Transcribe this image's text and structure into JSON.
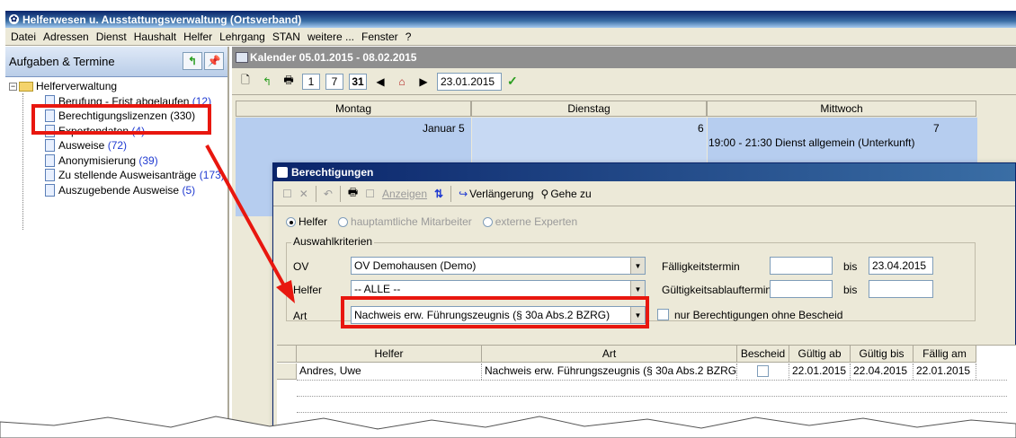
{
  "window": {
    "title": "Helferwesen u. Ausstattungsverwaltung (Ortsverband)"
  },
  "menu": [
    "Datei",
    "Adressen",
    "Dienst",
    "Haushalt",
    "Helfer",
    "Lehrgang",
    "STAN",
    "weitere ...",
    "Fenster",
    "?"
  ],
  "left_panel": {
    "title": "Aufgaben & Termine",
    "root": "Helferverwaltung",
    "items": [
      {
        "label": "Berufung - Frist abgelaufen",
        "count": "(12)"
      },
      {
        "label": "Berechtigungslizenzen (330)",
        "count": ""
      },
      {
        "label": "Expertendaten",
        "count": "(4)"
      },
      {
        "label": "Ausweise",
        "count": "(72)"
      },
      {
        "label": "Anonymisierung",
        "count": "(39)"
      },
      {
        "label": "Zu stellende Ausweisanträge",
        "count": "(173)"
      },
      {
        "label": "Auszugebende Ausweise",
        "count": "(5)"
      }
    ]
  },
  "calendar": {
    "title": "Kalender 05.01.2015 - 08.02.2015",
    "date": "23.01.2015",
    "days": [
      "Montag",
      "Dienstag",
      "Mittwoch"
    ],
    "day_numbers": [
      "Januar 5",
      "6",
      "7"
    ],
    "event": "19:00 - 21:30 Dienst allgemein (Unterkunft)"
  },
  "dialog": {
    "title": "Berechtigungen",
    "toolbar": {
      "show": "Anzeigen",
      "extend": "Verlängerung",
      "goto": "Gehe zu"
    },
    "radios": [
      "Helfer",
      "hauptamtliche Mitarbeiter",
      "externe Experten"
    ],
    "group_label": "Auswahlkriterien",
    "fields": {
      "ov_label": "OV",
      "ov_value": "OV Demohausen (Demo)",
      "helfer_label": "Helfer",
      "helfer_value": "-- ALLE --",
      "art_label": "Art",
      "art_value": "Nachweis erw. Führungszeugnis (§ 30a Abs.2 BZRG)",
      "faellig_label": "Fälligkeitstermin",
      "bis1": "bis",
      "faellig_bis": "23.04.2015",
      "gueltig_label": "Gültigkeitsablauftermin",
      "bis2": "bis",
      "nur_label": "nur Berechtigungen ohne Bescheid"
    },
    "columns": [
      "Helfer",
      "Art",
      "Bescheid",
      "Gültig ab",
      "Gültig bis",
      "Fällig am"
    ],
    "rows": [
      [
        "Andres, Uwe",
        "Nachweis erw. Führungszeugnis (§ 30a Abs.2 BZRG)",
        "",
        "22.01.2015",
        "22.04.2015",
        "22.01.2015"
      ]
    ]
  },
  "colors": {
    "annotation": "#e8170f",
    "calendar_cell": "#b6cdef",
    "titlebar": "#0a246a"
  }
}
